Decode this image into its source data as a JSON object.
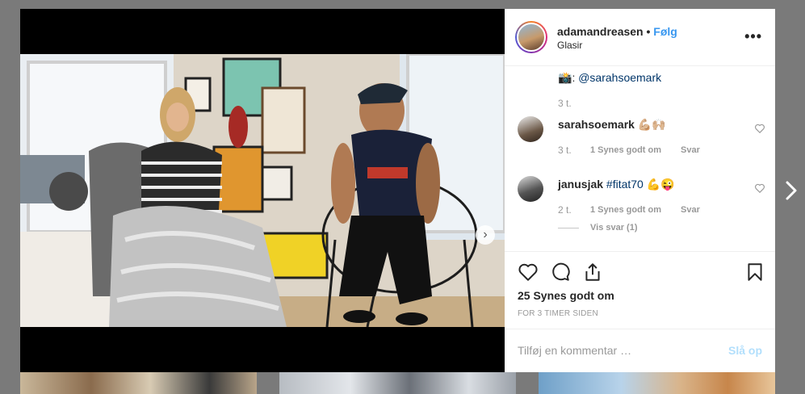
{
  "post": {
    "username": "adamandreasen",
    "separator": "•",
    "follow_label": "Følg",
    "location": "Glasir",
    "more_label": "•••"
  },
  "caption": {
    "emoji": "📸",
    "text": ": ",
    "mention": "@sarahsoemark",
    "time": "3 t."
  },
  "comments": [
    {
      "username": "sarahsoemark",
      "text": "💪🏼🙌🏼",
      "time": "3 t.",
      "likes": "1 Synes godt om",
      "reply": "Svar"
    },
    {
      "username": "janusjak",
      "text": "#fitat70 💪😜",
      "time": "2 t.",
      "likes": "1 Synes godt om",
      "reply": "Svar",
      "view_replies": "Vis svar (1)"
    }
  ],
  "likes_text": "25 Synes godt om",
  "time_ago": "FOR 3 TIMER SIDEN",
  "add_comment": {
    "placeholder": "Tilføj en kommentar …",
    "post_label": "Slå op"
  },
  "carousel": {
    "count": 2,
    "active": 0
  },
  "icons": {
    "like": "heart-icon",
    "comment": "comment-bubble-icon",
    "share": "share-icon",
    "save": "bookmark-icon",
    "next": "chevron-right-icon",
    "tag": "user-tag-icon"
  },
  "colors": {
    "link": "#003569",
    "follow": "#3897f0",
    "post_disabled": "#b2dffc",
    "muted": "#999999"
  }
}
